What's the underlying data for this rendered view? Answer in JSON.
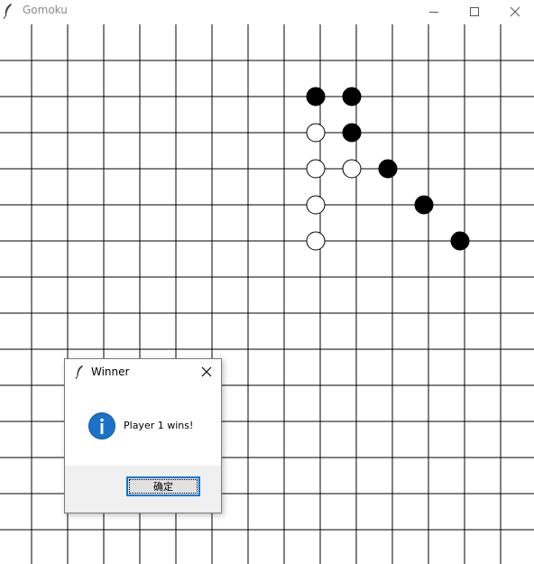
{
  "window": {
    "title": "Gomoku"
  },
  "board": {
    "line_color": "#000000",
    "black_color": "#000000",
    "white_color": "#ffffff",
    "black_stones": [
      [
        8,
        2
      ],
      [
        9,
        2
      ],
      [
        9,
        3
      ],
      [
        10,
        4
      ],
      [
        11,
        5
      ],
      [
        12,
        6
      ]
    ],
    "white_stones": [
      [
        8,
        3
      ],
      [
        8,
        4
      ],
      [
        9,
        4
      ],
      [
        8,
        5
      ],
      [
        8,
        6
      ]
    ]
  },
  "dialog": {
    "title": "Winner",
    "message": "Player 1 wins!",
    "ok_label": "确定",
    "icon": "info-icon",
    "accent": "#0078d7"
  }
}
